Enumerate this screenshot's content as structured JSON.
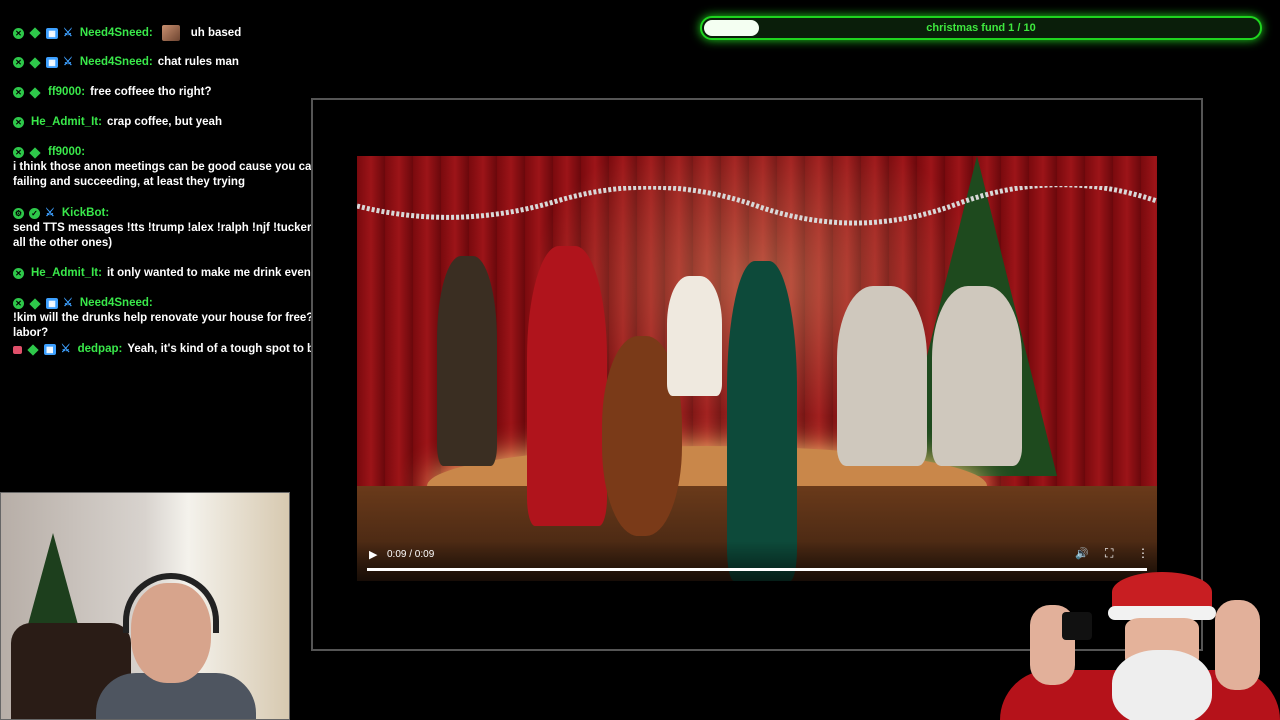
{
  "progress": {
    "label": "christmas fund 1 / 10",
    "current": 1,
    "total": 10,
    "fraction": 0.1,
    "fill_color": "#f4fff2",
    "accent_color": "#1fd41f"
  },
  "chat": {
    "username_color": "#39e84a",
    "messages": [
      {
        "user": "Need4Sneed:",
        "text": "uh based",
        "emote": true
      },
      {
        "user": "Need4Sneed:",
        "text": "chat rules man"
      },
      {
        "user": "ff9000:",
        "text": "free coffeee tho right?"
      },
      {
        "user": "He_Admit_It:",
        "text": "crap coffee, but yeah"
      },
      {
        "user": "ff9000:",
        "text": "i think those anon meetings can be good cause you can hear about other people failing and succeeding, at least they trying"
      },
      {
        "user": "KickBot:",
        "text": "send TTS messages !tts !trump !alex !ralph !njf !tucker !teddy !bean !dambit (and all the other ones)"
      },
      {
        "user": "He_Admit_It:",
        "text": "it only wanted to make me drink even more!"
      },
      {
        "user": "Need4Sneed:",
        "text": "!kim will the drunks help renovate your house for free? Can you use them as slave labor?"
      },
      {
        "user": "dedpap:",
        "text": "Yeah, it's kind of a tough spot to be in getting out with nothing"
      }
    ]
  },
  "video": {
    "time": "0:09 / 0:09",
    "play_icon": "play-icon",
    "volume_icon": "volume-icon",
    "fullscreen_icon": "fullscreen-icon",
    "more_icon": "more-vertical-icon",
    "progress_fraction": 1.0
  }
}
